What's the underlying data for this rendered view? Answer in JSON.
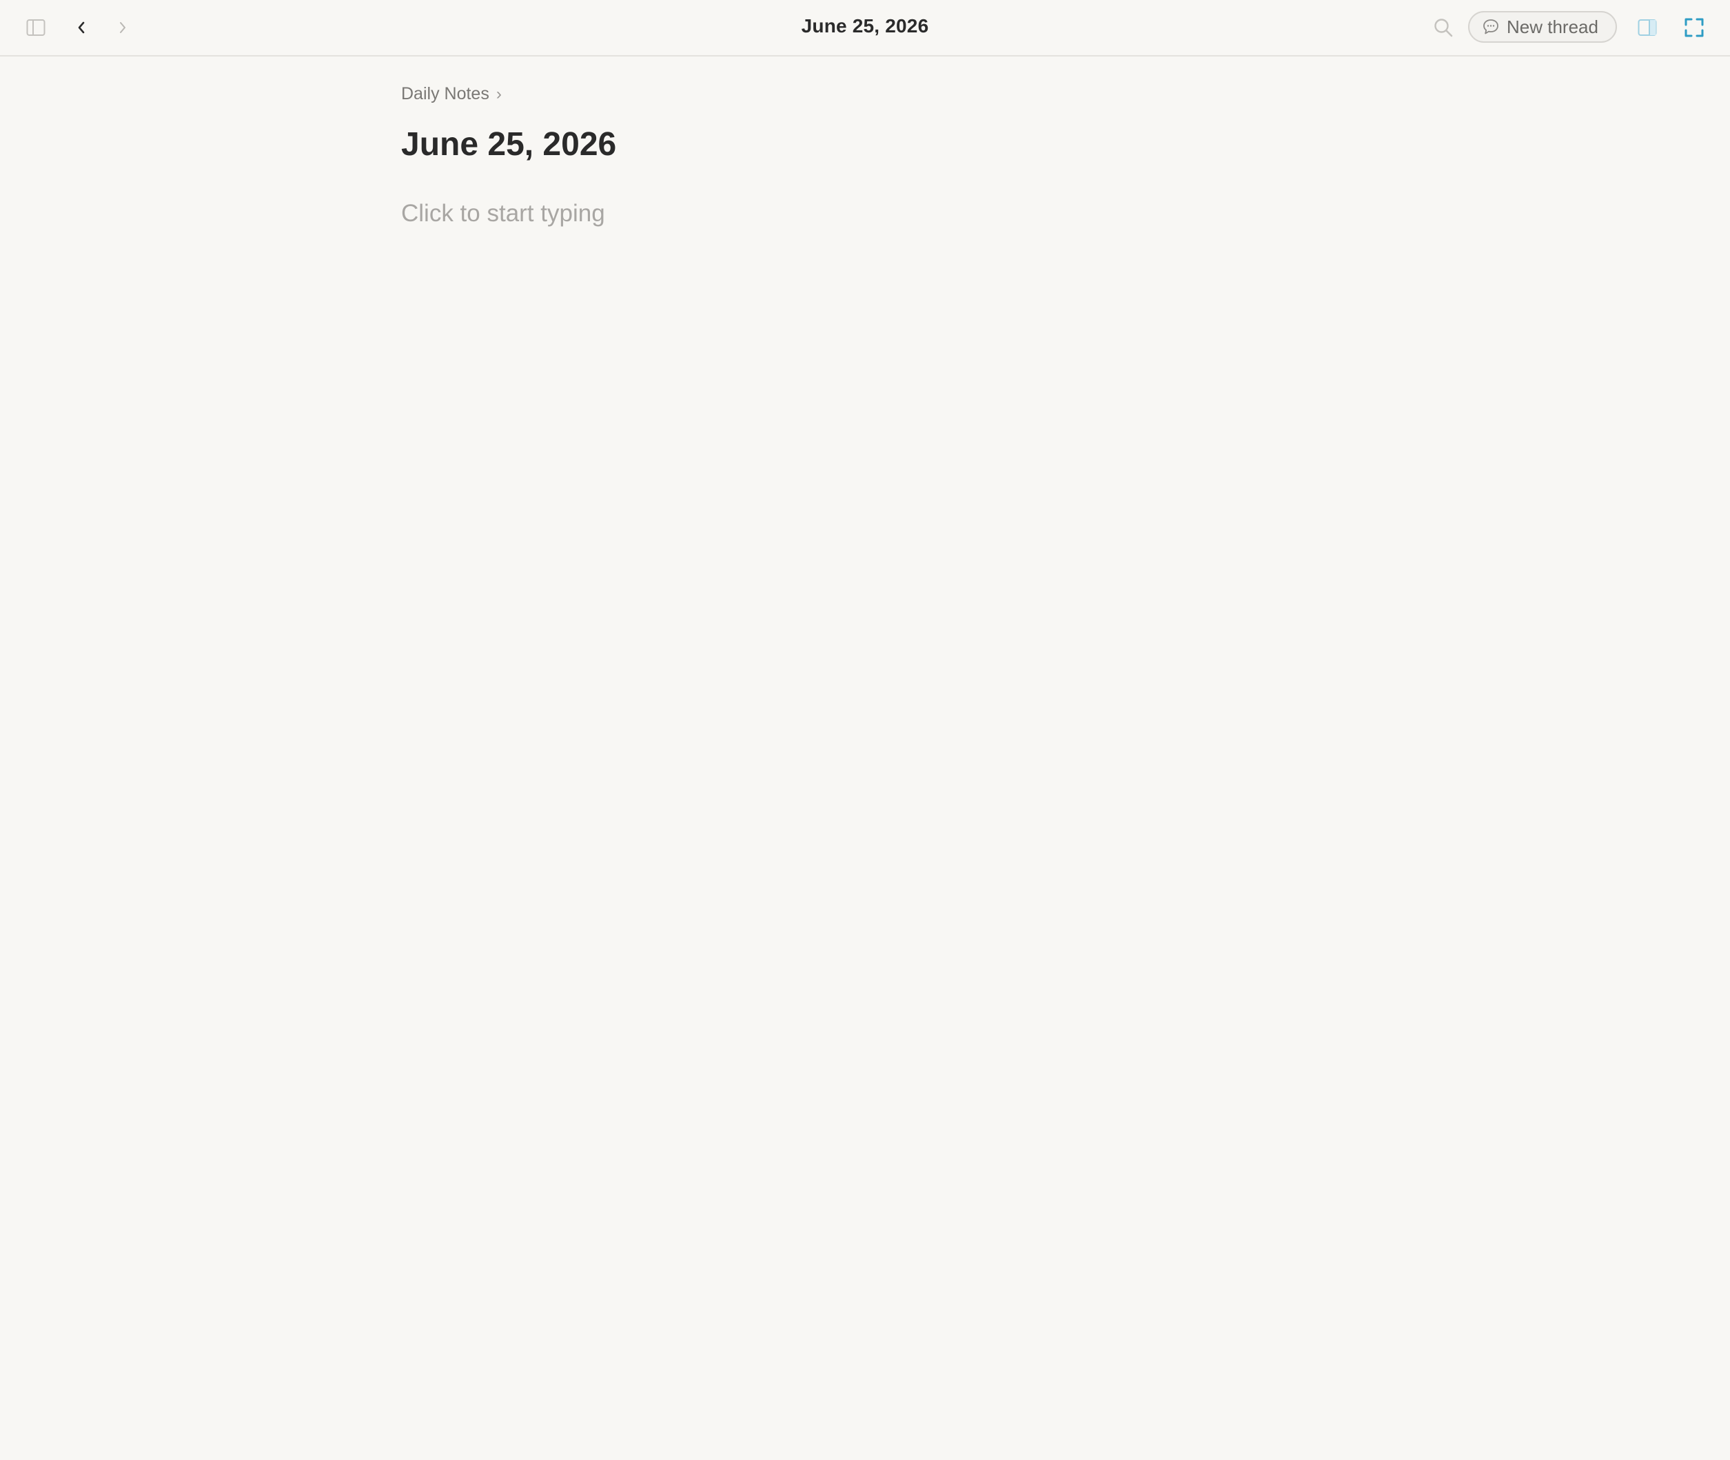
{
  "topbar": {
    "title": "June 25, 2026",
    "new_thread_label": "New thread",
    "icons": {
      "sidebar_toggle": "sidebar-left-icon",
      "back": "chevron-left-icon",
      "forward": "chevron-right-icon",
      "search": "search-icon",
      "new_thread": "speech-bubble-icon",
      "right_panel": "sidebar-right-icon",
      "fullscreen": "expand-icon"
    }
  },
  "breadcrumb": {
    "items": [
      {
        "label": "Daily Notes"
      }
    ],
    "separator": "›"
  },
  "page": {
    "title": "June 25, 2026",
    "placeholder": "Click to start typing"
  },
  "colors": {
    "background": "#f8f7f4",
    "accent": "#2e9cc4",
    "text": "#2a2a2a",
    "muted": "#a8a6a3"
  }
}
